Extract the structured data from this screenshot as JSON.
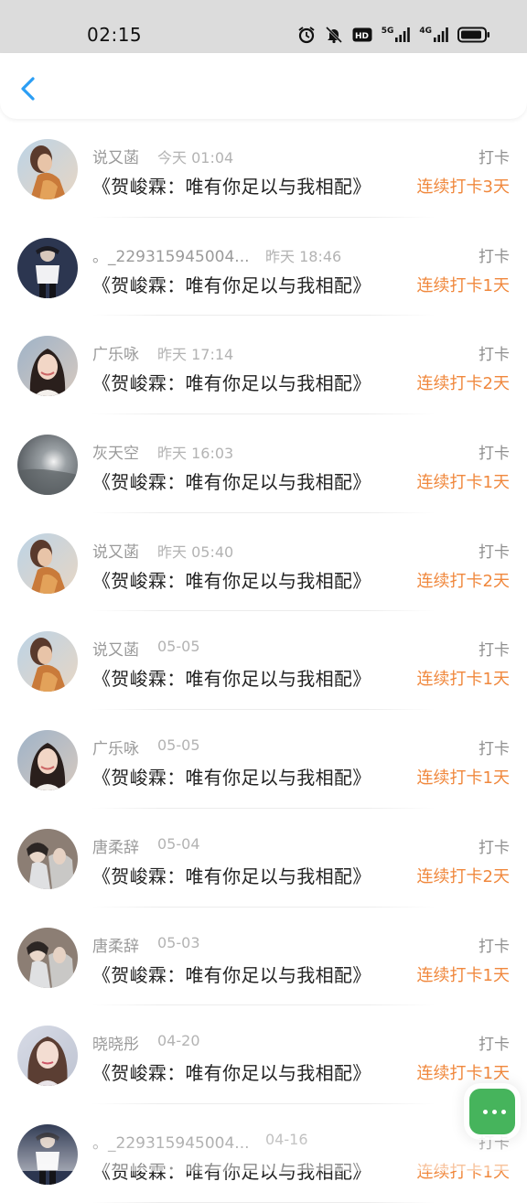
{
  "status_bar": {
    "time": "02:15",
    "network": [
      "5G",
      "4G"
    ],
    "icons": [
      "alarm-icon",
      "bell-off-icon",
      "hd-icon",
      "signal-5g-icon",
      "signal-4g-icon",
      "battery-icon"
    ]
  },
  "nav": {
    "back_icon": "chevron-left-icon",
    "accent_color": "#2b9ef4"
  },
  "list": {
    "checkin_label": "打卡",
    "items": [
      {
        "user": "说又菡",
        "time": "今天 01:04",
        "title": "《贺峻霖：唯有你足以与我相配》",
        "checkin": "打卡",
        "streak": "连续打卡3天"
      },
      {
        "user": "。_229315945004...",
        "time": "昨天 18:46",
        "title": "《贺峻霖：唯有你足以与我相配》",
        "checkin": "打卡",
        "streak": "连续打卡1天"
      },
      {
        "user": "广乐咏",
        "time": "昨天 17:14",
        "title": "《贺峻霖：唯有你足以与我相配》",
        "checkin": "打卡",
        "streak": "连续打卡2天"
      },
      {
        "user": "灰天空",
        "time": "昨天 16:03",
        "title": "《贺峻霖：唯有你足以与我相配》",
        "checkin": "打卡",
        "streak": "连续打卡1天"
      },
      {
        "user": "说又菡",
        "time": "昨天 05:40",
        "title": "《贺峻霖：唯有你足以与我相配》",
        "checkin": "打卡",
        "streak": "连续打卡2天"
      },
      {
        "user": "说又菡",
        "time": "05-05",
        "title": "《贺峻霖：唯有你足以与我相配》",
        "checkin": "打卡",
        "streak": "连续打卡1天"
      },
      {
        "user": "广乐咏",
        "time": "05-05",
        "title": "《贺峻霖：唯有你足以与我相配》",
        "checkin": "打卡",
        "streak": "连续打卡1天"
      },
      {
        "user": "唐柔辞",
        "time": "05-04",
        "title": "《贺峻霖：唯有你足以与我相配》",
        "checkin": "打卡",
        "streak": "连续打卡2天"
      },
      {
        "user": "唐柔辞",
        "time": "05-03",
        "title": "《贺峻霖：唯有你足以与我相配》",
        "checkin": "打卡",
        "streak": "连续打卡1天"
      },
      {
        "user": "晓晓彤",
        "time": "04-20",
        "title": "《贺峻霖：唯有你足以与我相配》",
        "checkin": "打卡",
        "streak": "连续打卡1天"
      },
      {
        "user": "。_229315945004...",
        "time": "04-16",
        "title": "《贺峻霖：唯有你足以与我相配》",
        "checkin": "打卡",
        "streak": "连续打卡1天"
      }
    ]
  },
  "fab": {
    "icon": "chat-bubble-icon",
    "color": "#46b45c"
  },
  "colors": {
    "streak": "#f0883d",
    "name": "#9a9a9a",
    "title": "#222222"
  }
}
